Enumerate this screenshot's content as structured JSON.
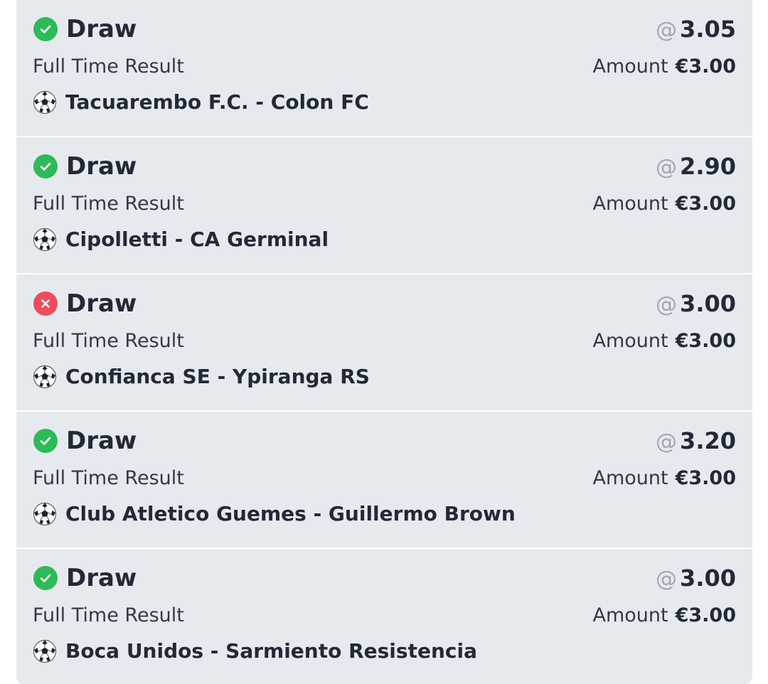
{
  "bets": [
    {
      "status": "won",
      "status_icon": "check-circle-icon",
      "selection": "Draw",
      "odds_prefix": "@",
      "odds": "3.05",
      "market": "Full Time Result",
      "amount_label": "Amount",
      "amount": "€3.00",
      "sport_icon": "soccer-ball-icon",
      "match": "Tacuarembo F.C. - Colon FC"
    },
    {
      "status": "won",
      "status_icon": "check-circle-icon",
      "selection": "Draw",
      "odds_prefix": "@",
      "odds": "2.90",
      "market": "Full Time Result",
      "amount_label": "Amount",
      "amount": "€3.00",
      "sport_icon": "soccer-ball-icon",
      "match": "Cipolletti - CA Germinal"
    },
    {
      "status": "lost",
      "status_icon": "x-circle-icon",
      "selection": "Draw",
      "odds_prefix": "@",
      "odds": "3.00",
      "market": "Full Time Result",
      "amount_label": "Amount",
      "amount": "€3.00",
      "sport_icon": "soccer-ball-icon",
      "match": "Confianca SE - Ypiranga RS"
    },
    {
      "status": "won",
      "status_icon": "check-circle-icon",
      "selection": "Draw",
      "odds_prefix": "@",
      "odds": "3.20",
      "market": "Full Time Result",
      "amount_label": "Amount",
      "amount": "€3.00",
      "sport_icon": "soccer-ball-icon",
      "match": "Club Atletico Guemes - Guillermo Brown"
    },
    {
      "status": "won",
      "status_icon": "check-circle-icon",
      "selection": "Draw",
      "odds_prefix": "@",
      "odds": "3.00",
      "market": "Full Time Result",
      "amount_label": "Amount",
      "amount": "€3.00",
      "sport_icon": "soccer-ball-icon",
      "match": "Boca Unidos - Sarmiento Resistencia"
    }
  ],
  "colors": {
    "card_background": "#e6eaee",
    "won": "#2dba58",
    "lost": "#ee4b5d",
    "text_primary": "#212a36",
    "text_muted": "#a1a7ae"
  }
}
